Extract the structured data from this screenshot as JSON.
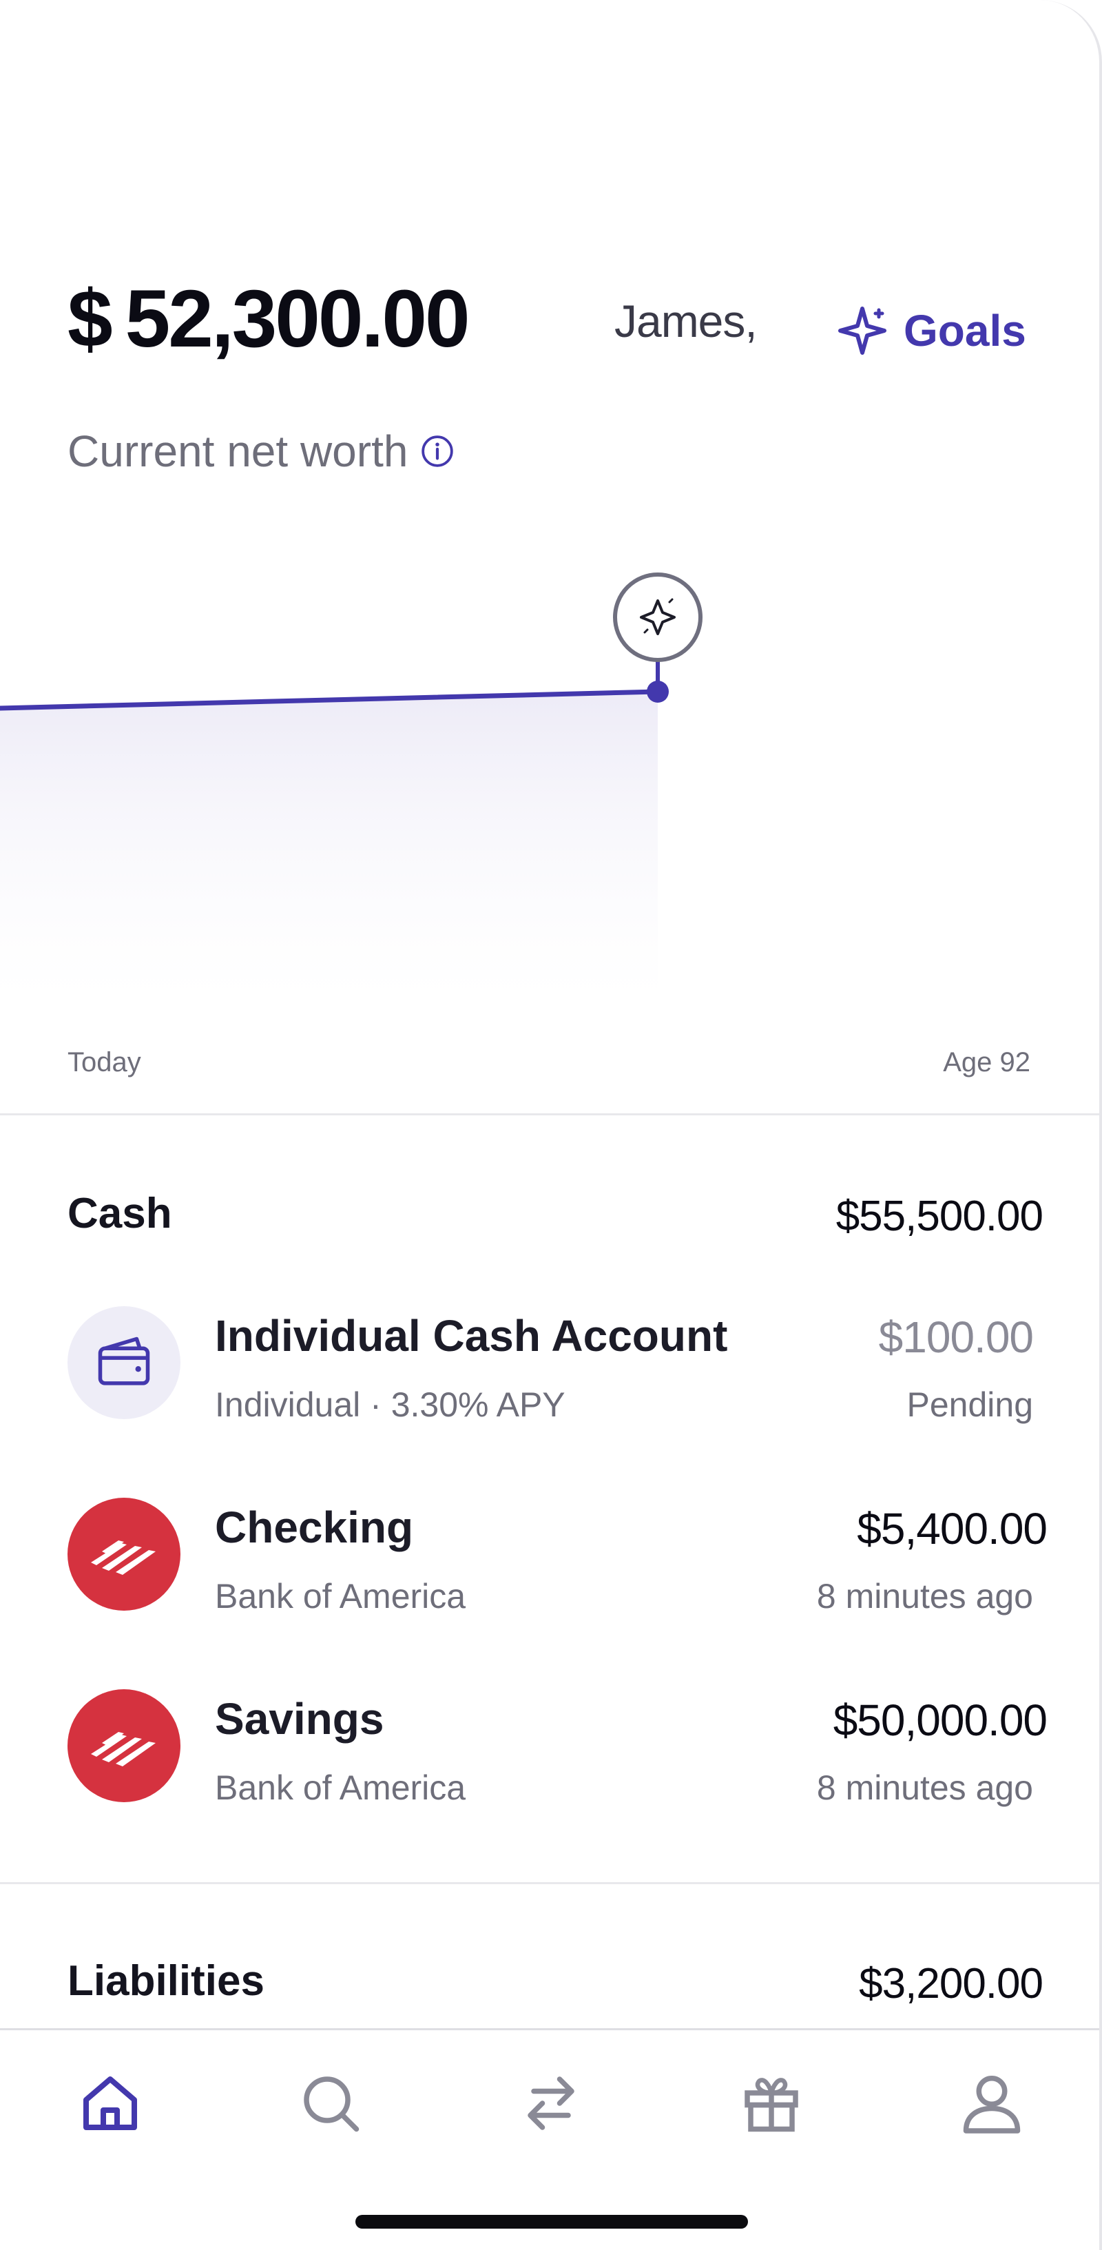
{
  "header": {
    "currency_symbol": "$",
    "net_worth": "52,300.00",
    "greeting": "James,",
    "goals_label": "Goals",
    "net_worth_label": "Current net worth"
  },
  "chart": {
    "start_label": "Today",
    "end_label": "Age 92"
  },
  "chart_data": {
    "type": "area",
    "x": [
      "Today",
      "Goal"
    ],
    "y_units": "USD",
    "accent_color": "#4338ad"
  },
  "cash": {
    "title": "Cash",
    "total": "$55,500.00",
    "accounts": [
      {
        "name": "Individual Cash Account",
        "subtitle": "Individual · 3.30% APY",
        "amount": "$100.00",
        "status": "Pending",
        "icon": "wallet-icon"
      },
      {
        "name": "Checking",
        "subtitle": "Bank of America",
        "amount": "$5,400.00",
        "status": "8 minutes ago",
        "icon": "bank-of-america-logo"
      },
      {
        "name": "Savings",
        "subtitle": "Bank of America",
        "amount": "$50,000.00",
        "status": "8 minutes ago",
        "icon": "bank-of-america-logo"
      }
    ]
  },
  "liabilities": {
    "title": "Liabilities",
    "total": "$3,200.00"
  },
  "tabbar": {
    "items": [
      "home-icon",
      "search-icon",
      "transfer-icon",
      "gift-icon",
      "profile-icon"
    ],
    "active": "home-icon"
  },
  "colors": {
    "accent": "#4338ad",
    "bank_red": "#d5323f",
    "muted_text": "#6e6e7a"
  }
}
